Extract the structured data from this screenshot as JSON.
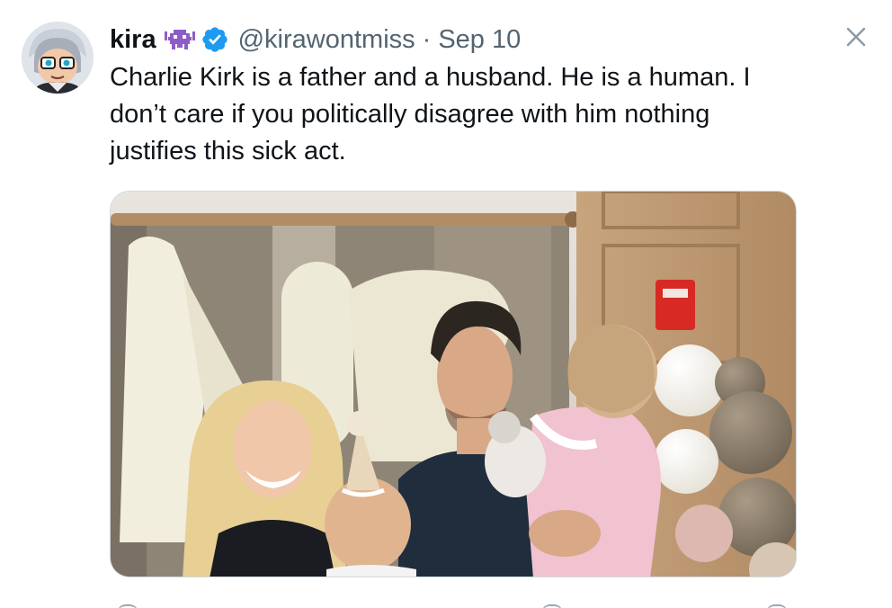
{
  "tweet": {
    "display_name": "kira",
    "handle": "@kirawontmiss",
    "separator": "·",
    "date": "Sep 10",
    "text": "Charlie Kirk is a father and a husband. He is a human. I don’t care if you politically disagree with him nothing justifies this sick act.",
    "name_emoji": "alien-monster-icon",
    "badge": "verified-badge-icon"
  },
  "colors": {
    "text_primary": "#0f1419",
    "text_secondary": "#536471",
    "verified_blue": "#1d9bf0",
    "emoji_purple": "#8e5cc8",
    "border": "#cfd9de"
  },
  "icons": {
    "close": "close-icon",
    "avatar": "avatar"
  }
}
